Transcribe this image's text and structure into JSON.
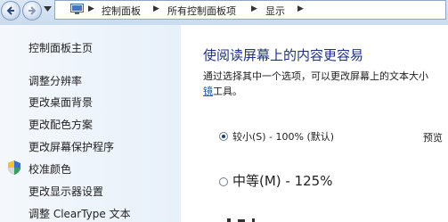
{
  "address_bar": {
    "breadcrumbs": [
      "控制面板",
      "所有控制面板项",
      "显示"
    ]
  },
  "sidebar": {
    "home": "控制面板主页",
    "links": [
      "调整分辨率",
      "更改桌面背景",
      "更改配色方案",
      "更改屏幕保护程序",
      "校准颜色",
      "更改显示器设置",
      "调整 ClearType 文本"
    ]
  },
  "main": {
    "title": "使阅读屏幕上的内容更容易",
    "description_line1": "通过选择其中一个选项，可以更改屏幕上的文本大小",
    "description_link": "镜",
    "description_tail": "工具。",
    "options": [
      {
        "label": "较小(S) - 100% (默认)",
        "selected": true
      },
      {
        "label": "中等(M) - 125%",
        "selected": false
      }
    ],
    "preview_label": "预览"
  }
}
